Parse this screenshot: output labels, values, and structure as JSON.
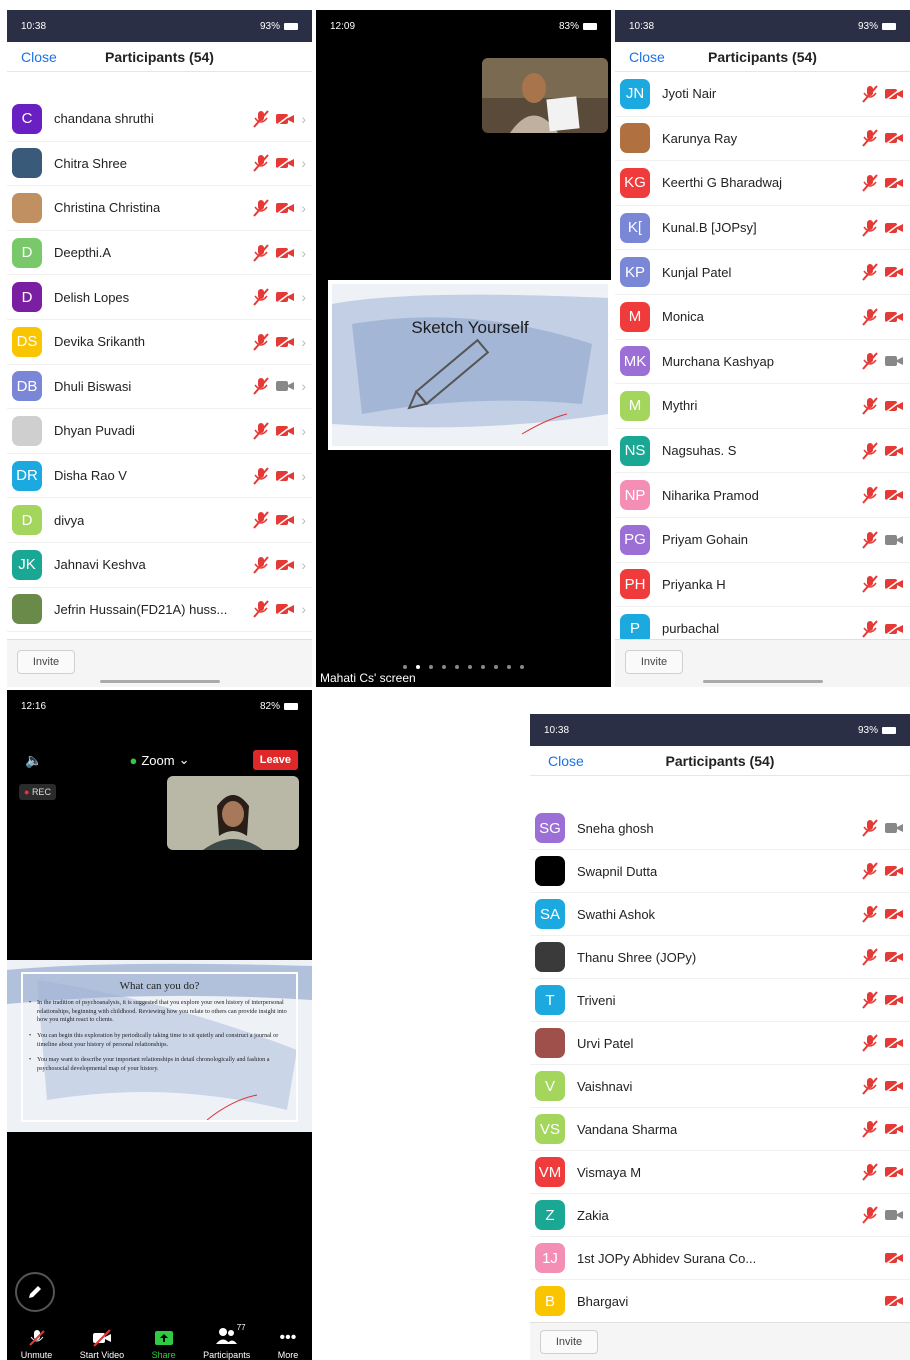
{
  "panel1": {
    "status": {
      "time": "10:38",
      "battery": "93%"
    },
    "header": {
      "close": "Close",
      "title": "Participants (54)"
    },
    "rows": [
      {
        "initials": "C",
        "name": "chandana shruthi",
        "color": "#6a1fc2",
        "mic": "muted",
        "cam": "off"
      },
      {
        "initials": "",
        "name": "Chitra Shree",
        "color": "#3a5a7a",
        "mic": "muted",
        "cam": "off",
        "photo": true
      },
      {
        "initials": "",
        "name": "Christina Christina",
        "color": "#c09060",
        "mic": "muted",
        "cam": "off",
        "photo": true
      },
      {
        "initials": "D",
        "name": "Deepthi.A",
        "color": "#79c86a",
        "mic": "muted",
        "cam": "off"
      },
      {
        "initials": "D",
        "name": "Delish Lopes",
        "color": "#7b1fa2",
        "mic": "muted",
        "cam": "off"
      },
      {
        "initials": "DS",
        "name": "Devika Srikanth",
        "color": "#f9c400",
        "mic": "muted",
        "cam": "off"
      },
      {
        "initials": "DB",
        "name": "Dhuli Biswasi",
        "color": "#7a87d6",
        "mic": "muted",
        "cam": "on"
      },
      {
        "initials": "",
        "name": "Dhyan Puvadi",
        "color": "#cfcfcf",
        "mic": "muted",
        "cam": "off"
      },
      {
        "initials": "DR",
        "name": "Disha Rao V",
        "color": "#1ca9e0",
        "mic": "muted",
        "cam": "off"
      },
      {
        "initials": "D",
        "name": "divya",
        "color": "#a4d65e",
        "mic": "muted",
        "cam": "off"
      },
      {
        "initials": "JK",
        "name": "Jahnavi Keshva",
        "color": "#1aa894",
        "mic": "muted",
        "cam": "off"
      },
      {
        "initials": "",
        "name": "Jefrin Hussain(FD21A) huss...",
        "color": "#6a8a4a",
        "mic": "muted",
        "cam": "off",
        "photo": true
      }
    ],
    "invite": "Invite"
  },
  "panel2": {
    "status": {
      "time": "12:09",
      "battery": "83%"
    },
    "slide_title": "Sketch Yourself",
    "screen_label": "Mahati Cs' screen"
  },
  "panel3": {
    "status": {
      "time": "10:38",
      "battery": "93%"
    },
    "header": {
      "close": "Close",
      "title": "Participants (54)"
    },
    "rows": [
      {
        "initials": "JN",
        "name": "Jyoti Nair",
        "color": "#1ca9e0",
        "mic": "muted",
        "cam": "off"
      },
      {
        "initials": "",
        "name": "Karunya Ray",
        "color": "#b07040",
        "mic": "muted",
        "cam": "off",
        "photo": true
      },
      {
        "initials": "KG",
        "name": "Keerthi G Bharadwaj",
        "color": "#ef3b3b",
        "mic": "muted",
        "cam": "off"
      },
      {
        "initials": "K[",
        "name": "Kunal.B [JOPsy]",
        "color": "#7a87d6",
        "mic": "muted",
        "cam": "off"
      },
      {
        "initials": "KP",
        "name": "Kunjal Patel",
        "color": "#7a87d6",
        "mic": "muted",
        "cam": "off"
      },
      {
        "initials": "M",
        "name": "Monica",
        "color": "#ef3b3b",
        "mic": "muted",
        "cam": "off"
      },
      {
        "initials": "MK",
        "name": "Murchana Kashyap",
        "color": "#9b6fd6",
        "mic": "muted",
        "cam": "on"
      },
      {
        "initials": "M",
        "name": "Mythri",
        "color": "#a4d65e",
        "mic": "muted",
        "cam": "off"
      },
      {
        "initials": "NS",
        "name": "Nagsuhas. S",
        "color": "#1aa894",
        "mic": "muted",
        "cam": "off"
      },
      {
        "initials": "NP",
        "name": "Niharika Pramod",
        "color": "#f58eb5",
        "mic": "muted",
        "cam": "off"
      },
      {
        "initials": "PG",
        "name": "Priyam Gohain",
        "color": "#9b6fd6",
        "mic": "muted",
        "cam": "on"
      },
      {
        "initials": "PH",
        "name": "Priyanka H",
        "color": "#ef3b3b",
        "mic": "muted",
        "cam": "off"
      },
      {
        "initials": "P",
        "name": "purbachal",
        "color": "#1ca9e0",
        "mic": "muted",
        "cam": "off"
      }
    ],
    "invite": "Invite"
  },
  "panel4": {
    "status": {
      "time": "12:16",
      "battery": "82%"
    },
    "zoom_label": "Zoom",
    "leave": "Leave",
    "rec": "REC",
    "slide_title": "What can you do?",
    "bullets": [
      "In the tradition of psychoanalysis, it is suggested that you explore your own history of interpersonal relationships, beginning with childhood. Reviewing how you relate to others can provide insight into how you might react to clients.",
      "You can begin this exploration by periodically taking time to sit quietly and construct a journal or timeline about your history of personal relationships.",
      "You may want to describe your important relationships in detail chronologically and fashion a psychosocial developmental map of your history."
    ],
    "toolbar": {
      "unmute": "Unmute",
      "start_video": "Start Video",
      "share": "Share",
      "participants": "Participants",
      "participants_count": "77",
      "more": "More"
    }
  },
  "panel5": {
    "status": {
      "time": "10:38",
      "battery": "93%"
    },
    "header": {
      "close": "Close",
      "title": "Participants (54)"
    },
    "rows": [
      {
        "initials": "SG",
        "name": "Sneha ghosh",
        "color": "#9b6fd6",
        "mic": "muted",
        "cam": "on"
      },
      {
        "initials": "",
        "name": "Swapnil Dutta",
        "color": "#000000",
        "mic": "muted",
        "cam": "off"
      },
      {
        "initials": "SA",
        "name": "Swathi Ashok",
        "color": "#1ca9e0",
        "mic": "muted",
        "cam": "off"
      },
      {
        "initials": "",
        "name": "Thanu Shree (JOPy)",
        "color": "#3a3a3a",
        "mic": "muted",
        "cam": "off",
        "photo": true
      },
      {
        "initials": "T",
        "name": "Triveni",
        "color": "#1ca9e0",
        "mic": "muted",
        "cam": "off"
      },
      {
        "initials": "",
        "name": "Urvi Patel",
        "color": "#a0504a",
        "mic": "muted",
        "cam": "off",
        "photo": true
      },
      {
        "initials": "V",
        "name": "Vaishnavi",
        "color": "#a4d65e",
        "mic": "muted",
        "cam": "off"
      },
      {
        "initials": "VS",
        "name": "Vandana Sharma",
        "color": "#a4d65e",
        "mic": "muted",
        "cam": "off"
      },
      {
        "initials": "VM",
        "name": "Vismaya M",
        "color": "#ef3b3b",
        "mic": "muted",
        "cam": "off"
      },
      {
        "initials": "Z",
        "name": "Zakia",
        "color": "#1aa894",
        "mic": "muted",
        "cam": "on"
      },
      {
        "initials": "1J",
        "name": "1st JOPy Abhidev Surana Co...",
        "color": "#f58eb5",
        "mic": "none",
        "cam": "off"
      },
      {
        "initials": "B",
        "name": "Bhargavi",
        "color": "#f9c400",
        "mic": "none",
        "cam": "off"
      }
    ],
    "invite": "Invite"
  },
  "colors": {
    "accent": "#1a73e8",
    "muted_red": "#e53935",
    "leave_red": "#e02828",
    "share_green": "#2ecc40"
  }
}
